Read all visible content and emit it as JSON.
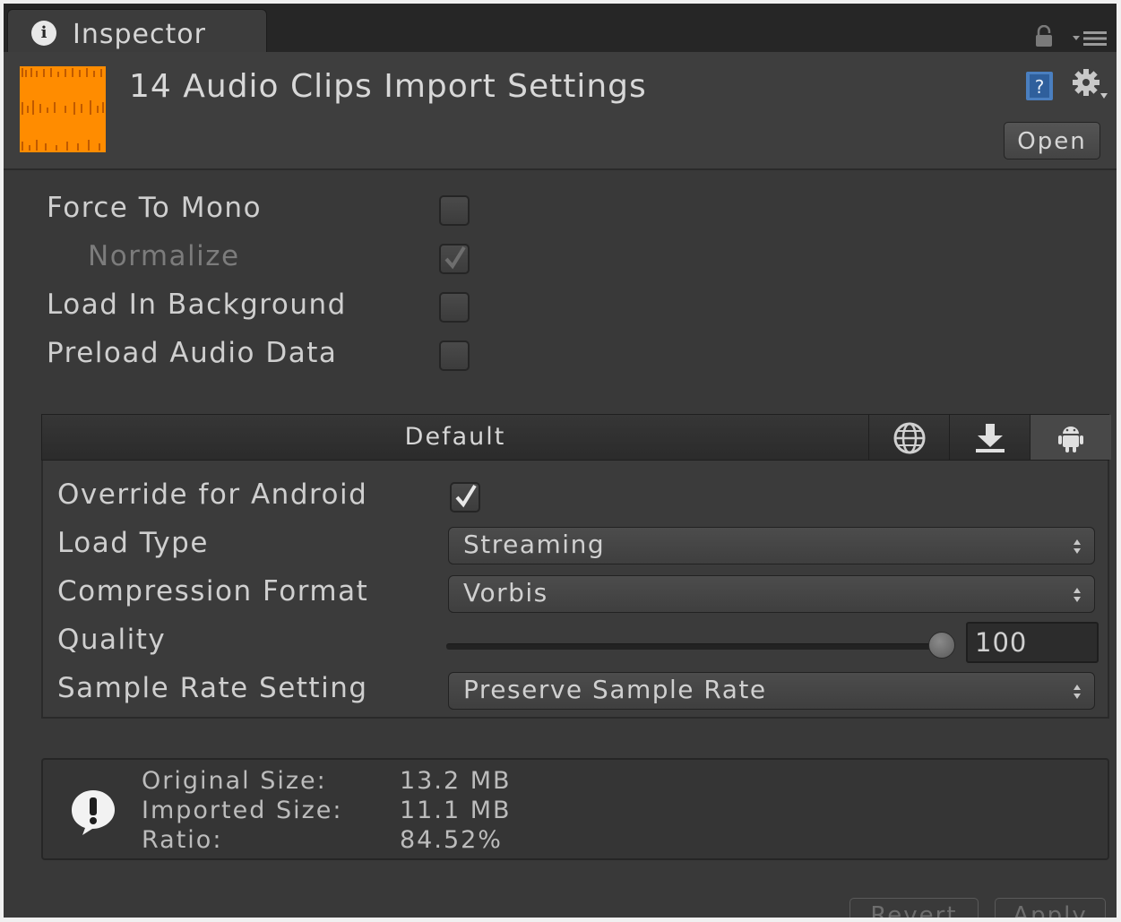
{
  "window": {
    "tab_title": "Inspector",
    "tab_icon": "info-icon",
    "tab_icon_glyph": "i"
  },
  "header": {
    "title": "14 Audio Clips Import Settings",
    "open_label": "Open",
    "accent": "#ff8c00"
  },
  "settings": {
    "force_to_mono": {
      "label": "Force To Mono",
      "checked": false
    },
    "normalize": {
      "label": "Normalize",
      "checked": true,
      "disabled": true
    },
    "load_in_background": {
      "label": "Load In Background",
      "checked": false
    },
    "preload_audio_data": {
      "label": "Preload Audio Data",
      "checked": false
    }
  },
  "platform_tabs": {
    "default_label": "Default",
    "icons": [
      "globe-icon",
      "download-icon",
      "android-icon"
    ],
    "active": "android-icon"
  },
  "platform_settings": {
    "override": {
      "label": "Override for Android",
      "checked": true
    },
    "load_type": {
      "label": "Load Type",
      "value": "Streaming"
    },
    "compression_format": {
      "label": "Compression Format",
      "value": "Vorbis"
    },
    "quality": {
      "label": "Quality",
      "value": "100",
      "slider_fraction": 1.0
    },
    "sample_rate_setting": {
      "label": "Sample Rate Setting",
      "value": "Preserve Sample Rate"
    }
  },
  "info": {
    "original_size_label": "Original Size:",
    "original_size_value": "13.2 MB",
    "imported_size_label": "Imported Size:",
    "imported_size_value": "11.1 MB",
    "ratio_label": "Ratio:",
    "ratio_value": "84.52%"
  },
  "footer": {
    "revert_label": "Revert",
    "apply_label": "Apply"
  }
}
